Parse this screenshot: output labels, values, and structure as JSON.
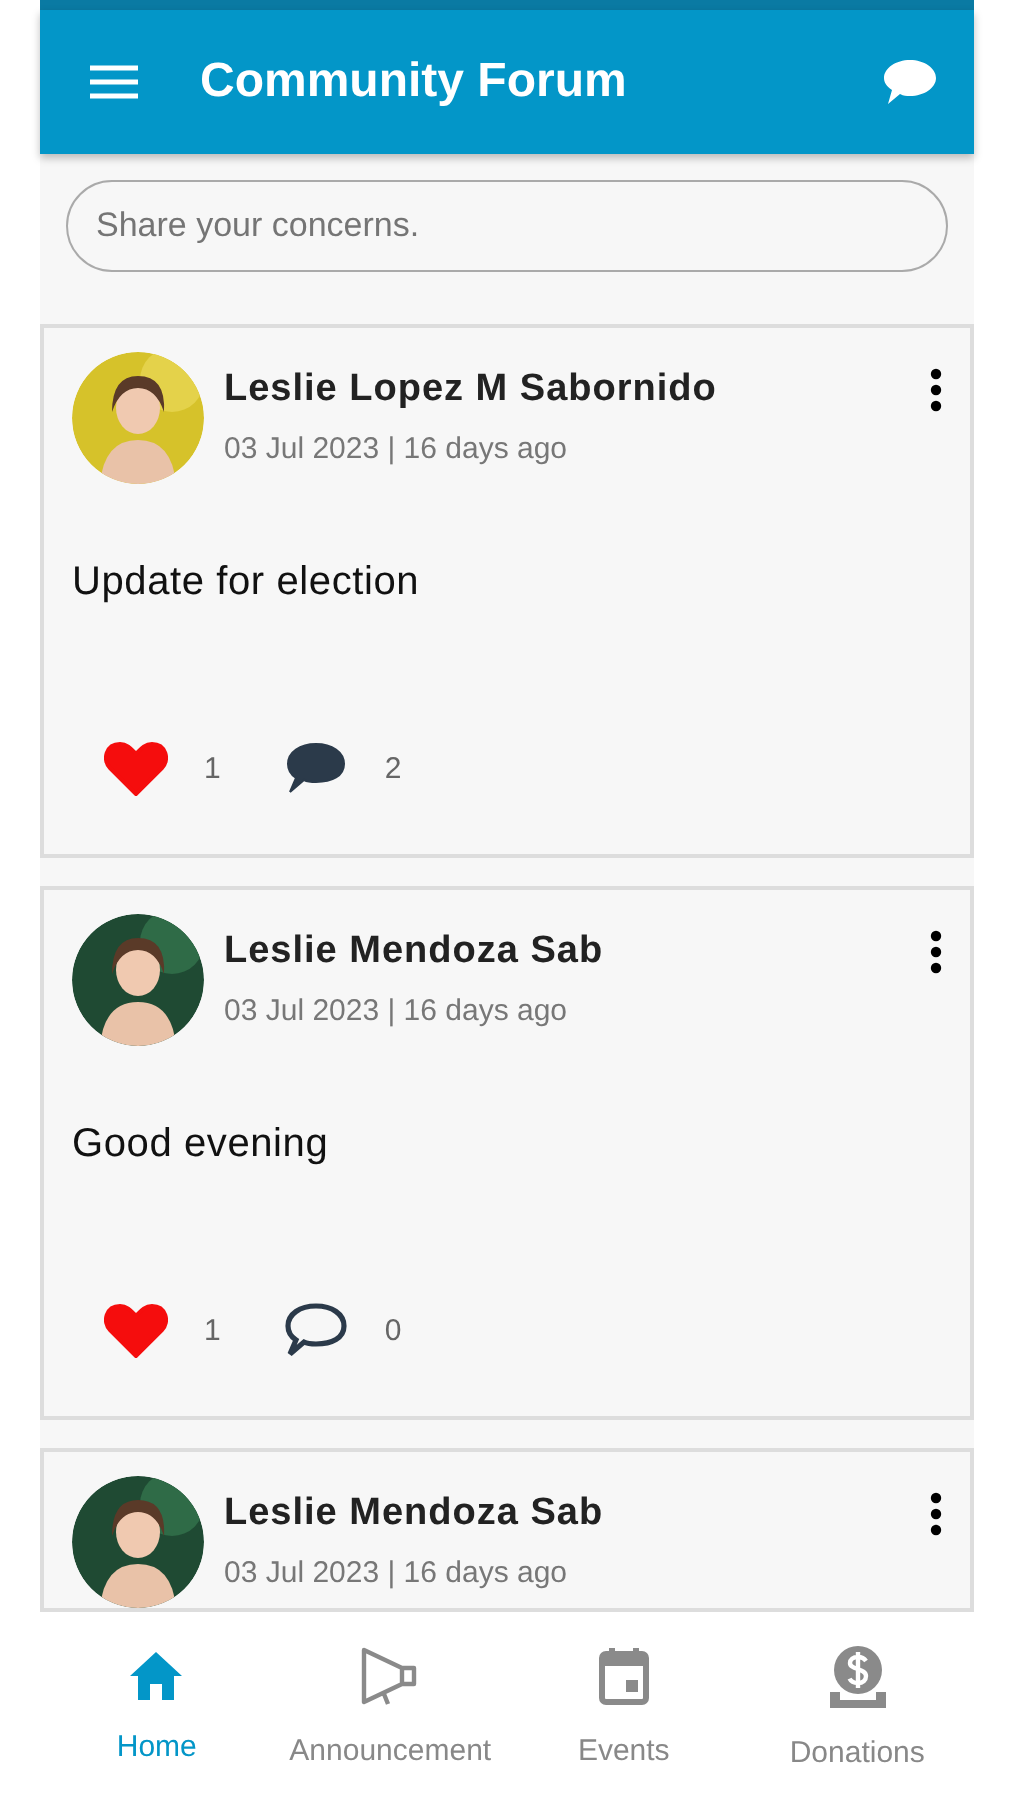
{
  "app_bar": {
    "title": "Community Forum"
  },
  "composer": {
    "placeholder": "Share your concerns."
  },
  "posts": [
    {
      "author": "Leslie Lopez M Sabornido",
      "meta": "03 Jul 2023 | 16 days ago",
      "text": "Update for election",
      "liked": true,
      "likes": "1",
      "commented": true,
      "comments": "2",
      "kind": "picture"
    },
    {
      "author": "Leslie Mendoza Sab",
      "meta": "03 Jul 2023 | 16 days ago",
      "text": "Good evening",
      "liked": true,
      "likes": "1",
      "commented": false,
      "comments": "0",
      "kind": "picture"
    },
    {
      "author": "Leslie Mendoza Sab",
      "meta": "03 Jul 2023 | 16 days ago",
      "kind": "picture"
    }
  ],
  "bottom_nav": [
    {
      "label": "Home",
      "kind": "home",
      "selected": true
    },
    {
      "label": "Announcement",
      "kind": "megaphone",
      "selected": false
    },
    {
      "label": "Events",
      "kind": "calendar",
      "selected": false
    },
    {
      "label": "Donations",
      "kind": "donation",
      "selected": false
    }
  ]
}
